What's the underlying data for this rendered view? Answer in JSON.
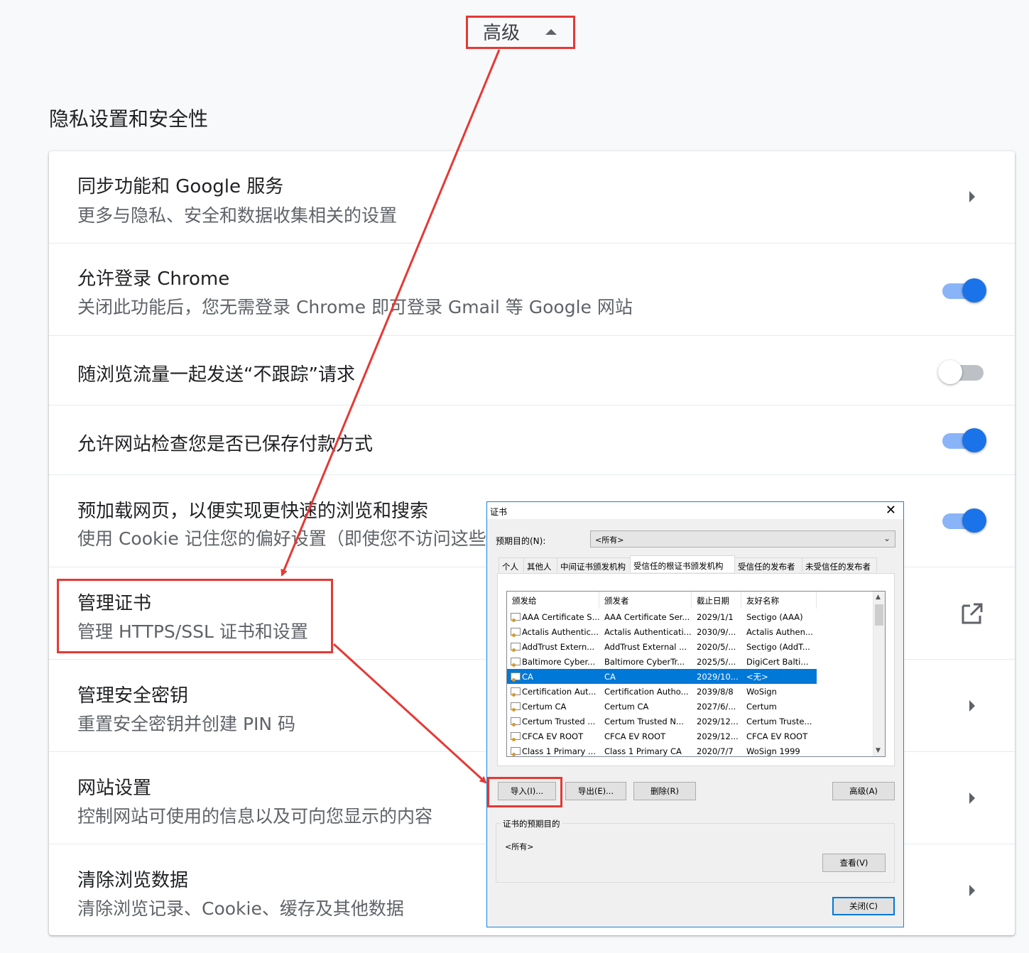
{
  "advanced": {
    "label": "高级"
  },
  "section_title": "隐私设置和安全性",
  "rows": [
    {
      "title": "同步功能和 Google 服务",
      "subtitle": "更多与隐私、安全和数据收集相关的设置",
      "control": "chevron"
    },
    {
      "title": "允许登录 Chrome",
      "subtitle": "关闭此功能后，您无需登录 Chrome 即可登录 Gmail 等 Google 网站",
      "control": "toggle",
      "on": true
    },
    {
      "title": "随浏览流量一起发送“不跟踪”请求",
      "control": "toggle",
      "on": false
    },
    {
      "title": "允许网站检查您是否已保存付款方式",
      "control": "toggle",
      "on": true
    },
    {
      "title": "预加载网页，以便实现更快速的浏览和搜索",
      "subtitle": "使用 Cookie 记住您的偏好设置（即使您不访问这些",
      "control": "toggle",
      "on": true
    },
    {
      "title": "管理证书",
      "subtitle": "管理 HTTPS/SSL 证书和设置",
      "control": "external-link"
    },
    {
      "title": "管理安全密钥",
      "subtitle": "重置安全密钥并创建 PIN 码",
      "control": "chevron"
    },
    {
      "title": "网站设置",
      "subtitle": "控制网站可使用的信息以及可向您显示的内容",
      "control": "chevron"
    },
    {
      "title": "清除浏览数据",
      "subtitle": "清除浏览记录、Cookie、缓存及其他数据",
      "control": "chevron"
    }
  ],
  "dialog": {
    "title": "证书",
    "close": "✕",
    "purpose_label": "预期目的(N):",
    "purpose_value": "<所有>",
    "tabs": [
      "个人",
      "其他人",
      "中间证书颁发机构",
      "受信任的根证书颁发机构",
      "受信任的发布者",
      "未受信任的发布者"
    ],
    "active_tab": 3,
    "columns": [
      "颁发给",
      "颁发者",
      "截止日期",
      "友好名称"
    ],
    "certificates": [
      [
        "AAA Certificate S...",
        "AAA Certificate Ser...",
        "2029/1/1",
        "Sectigo (AAA)"
      ],
      [
        "Actalis Authentic...",
        "Actalis Authenticati...",
        "2030/9/...",
        "Actalis Authen..."
      ],
      [
        "AddTrust Extern...",
        "AddTrust External ...",
        "2020/5/...",
        "Sectigo (AddT..."
      ],
      [
        "Baltimore Cyber...",
        "Baltimore CyberTr...",
        "2025/5/...",
        "DigiCert Balti..."
      ],
      [
        "CA",
        "CA",
        "2029/10...",
        "<无>"
      ],
      [
        "Certification Aut...",
        "Certification Autho...",
        "2039/8/8",
        "WoSign"
      ],
      [
        "Certum CA",
        "Certum CA",
        "2027/6/...",
        "Certum"
      ],
      [
        "Certum Trusted ...",
        "Certum Trusted N...",
        "2029/12...",
        "Certum Truste..."
      ],
      [
        "CFCA EV ROOT",
        "CFCA EV ROOT",
        "2029/12...",
        "CFCA EV ROOT"
      ],
      [
        "Class 1 Primary ...",
        "Class 1 Primary CA",
        "2020/7/7",
        "WoSign 1999"
      ]
    ],
    "selected_index": 4,
    "buttons": {
      "import": "导入(I)...",
      "export": "导出(E)...",
      "remove": "删除(R)",
      "advanced": "高级(A)",
      "view": "查看(V)",
      "close": "关闭(C)"
    },
    "purposes_group": {
      "label": "证书的预期目的",
      "value": "<所有>"
    }
  },
  "colors": {
    "accent": "#1a73e8",
    "annotation": "#e53935",
    "selection": "#0078d7"
  }
}
